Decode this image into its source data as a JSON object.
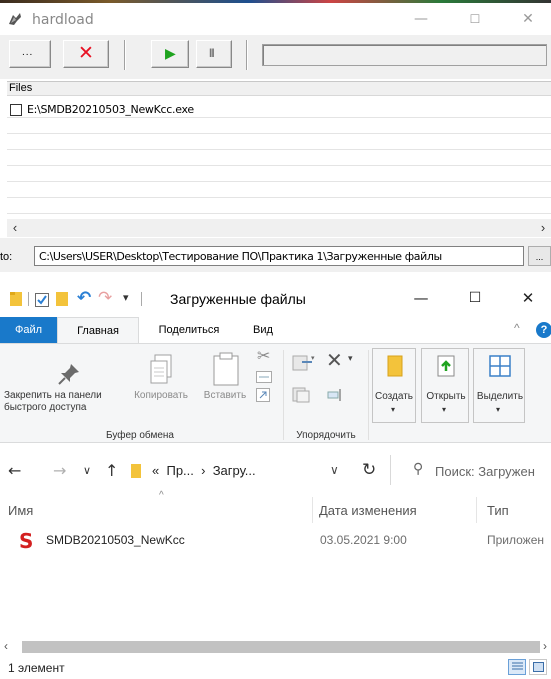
{
  "hardload": {
    "title": "hardload",
    "toolbar": {
      "more_label": "...",
      "cancel_symbol": "✕",
      "play_symbol": "▶",
      "pause_symbol": "II"
    },
    "files_header": "Files",
    "files": [
      {
        "name": "E:\\SMDB20210503_NewKcc.exe",
        "checked": false
      }
    ],
    "to_label": "to:",
    "to_path": "C:\\Users\\USER\\Desktop\\Тестирование ПО\\Практика 1\\Загруженные файлы",
    "browse_label": "..."
  },
  "explorer": {
    "title": "Загруженные файлы",
    "window_controls": {
      "minimize": "—",
      "maximize": "☐",
      "close": "✕"
    },
    "tabs": [
      "Файл",
      "Главная",
      "Поделиться",
      "Вид"
    ],
    "active_tab": "Главная",
    "help": "?",
    "ribbon": {
      "pin_label": "Закрепить на панели быстрого доступа",
      "copy_label": "Копировать",
      "paste_label": "Вставить",
      "clipboard_group": "Буфер обмена",
      "organize_group": "Упорядочить",
      "create_label": "Создать",
      "open_label": "Открыть",
      "select_label": "Выделить"
    },
    "breadcrumb": [
      "«",
      "Пр...",
      "›",
      "Загру..."
    ],
    "search_placeholder": "Поиск: Загружен",
    "columns": {
      "name": "Имя",
      "date": "Дата изменения",
      "type": "Тип"
    },
    "rows": [
      {
        "name": "SMDB20210503_NewKcc",
        "date": "03.05.2021 9:00",
        "type": "Приложен"
      }
    ],
    "status": "1 элемент"
  },
  "colors": {
    "accent_blue": "#1979ca",
    "play_green": "#1fa31f",
    "cancel_red": "#e81123",
    "s_icon_red": "#d32020"
  }
}
